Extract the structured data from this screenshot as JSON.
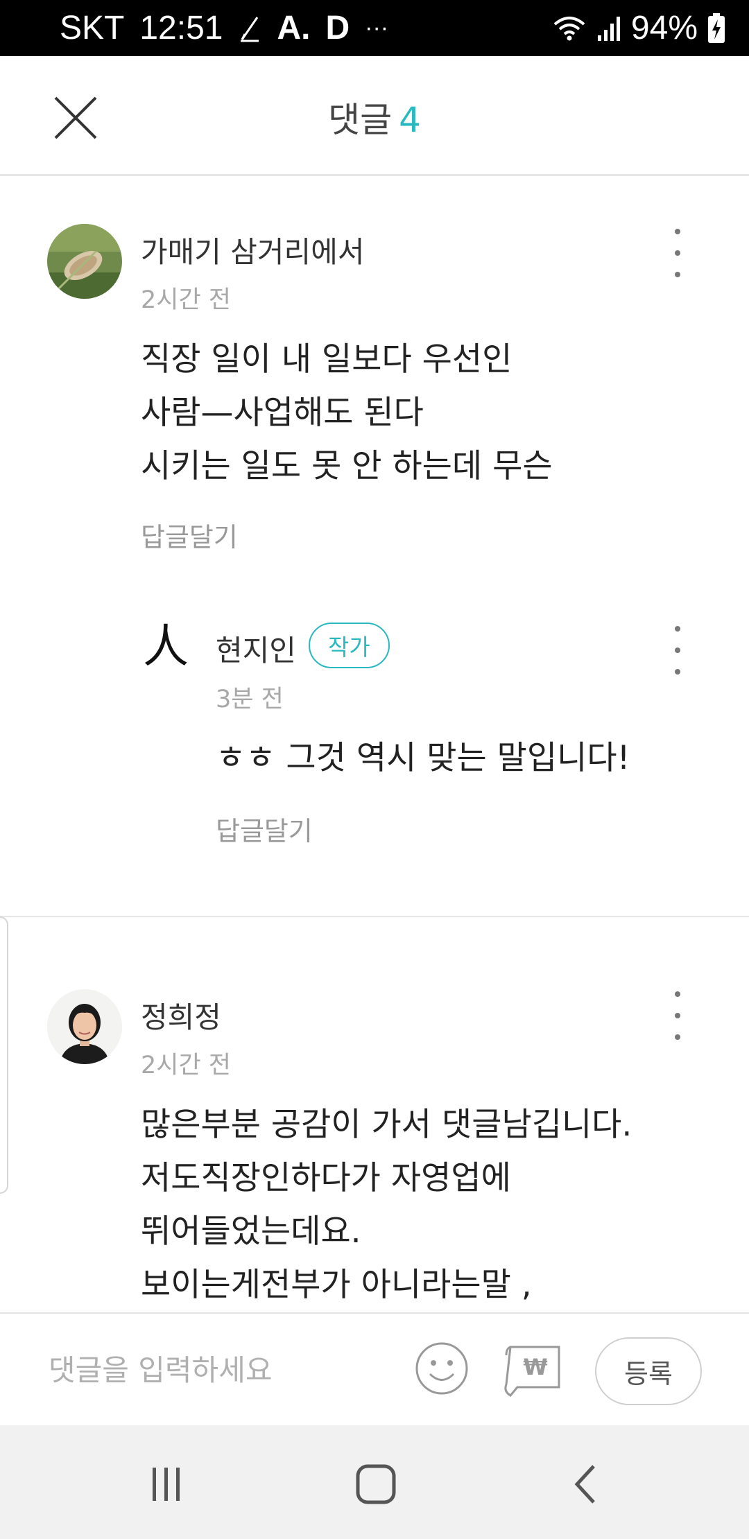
{
  "status_bar": {
    "carrier": "SKT",
    "time": "12:51",
    "notif_a": "A.",
    "notif_d": "D",
    "more": "···",
    "battery": "94%"
  },
  "header": {
    "title": "댓글",
    "count": "4"
  },
  "comments": [
    {
      "author": "가매기 삼거리에서",
      "time": "2시간 전",
      "text": "직장 일이 내 일보다 우선인\n사람—사업해도 된다\n시키는 일도 못 안 하는데 무슨",
      "reply_label": "답글달기"
    },
    {
      "author": "정희정",
      "time": "2시간 전",
      "text": "많은부분 공감이 가서 댓글남깁니다.\n저도직장인하다가 자영업에\n뛰어들었는데요.\n보이는게전부가 아니라는말 ,"
    }
  ],
  "reply": {
    "avatar_glyph": "人",
    "author": "현지인",
    "badge": "작가",
    "time": "3분 전",
    "text": "ㅎㅎ 그것 역시 맞는 말입니다!",
    "reply_label": "답글달기"
  },
  "input_bar": {
    "placeholder": "댓글을 입력하세요",
    "submit_label": "등록",
    "support_symbol": "₩"
  },
  "icons": {
    "close": "close-icon",
    "more": "more-vertical-icon",
    "emoji": "smiley-icon",
    "support": "won-ticket-icon",
    "nav_recent": "recent-apps-icon",
    "nav_home": "home-icon",
    "nav_back": "back-icon"
  },
  "colors": {
    "accent": "#2bb9c0",
    "status_bar": "#000000",
    "nav_bar": "#f1f1f1"
  }
}
